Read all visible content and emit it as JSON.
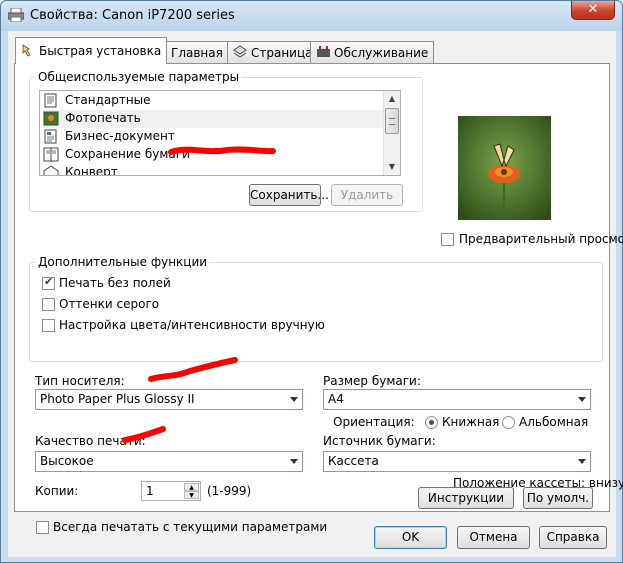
{
  "window": {
    "title": "Свойства: Canon iP7200 series",
    "close_glyph": "✕"
  },
  "tabs": [
    {
      "label": "Быстрая установка",
      "active": true,
      "icon": "quick-setup-icon"
    },
    {
      "label": "Главная",
      "active": false,
      "icon": "main-icon"
    },
    {
      "label": "Страница",
      "active": false,
      "icon": "page-setup-icon"
    },
    {
      "label": "Обслуживание",
      "active": false,
      "icon": "maintenance-icon"
    }
  ],
  "common_settings": {
    "group_label": "Общеиспользуемые параметры",
    "items": [
      {
        "label": "Стандартные",
        "icon": "standard-icon"
      },
      {
        "label": "Фотопечать",
        "icon": "photo-print-icon",
        "selected": true
      },
      {
        "label": "Бизнес-документ",
        "icon": "business-document-icon"
      },
      {
        "label": "Сохранение бумаги",
        "icon": "paper-saving-icon"
      },
      {
        "label": "Конверт",
        "icon": "envelope-icon"
      }
    ],
    "save_label": "Сохранить...",
    "delete_label": "Удалить"
  },
  "preview": {
    "checkbox_label": "Предварительный просмотр",
    "checked": false
  },
  "additional": {
    "group_label": "Дополнительные функции",
    "options": [
      {
        "label": "Печать без полей",
        "checked": true
      },
      {
        "label": "Оттенки серого",
        "checked": false
      },
      {
        "label": "Настройка цвета/интенсивности вручную",
        "checked": false
      }
    ]
  },
  "media_type": {
    "label": "Тип носителя:",
    "value": "Photo Paper Plus Glossy II"
  },
  "paper_size": {
    "label": "Размер бумаги:",
    "value": "A4"
  },
  "orientation": {
    "label": "Ориентация:",
    "portrait": "Книжная",
    "landscape": "Альбомная",
    "selected": "portrait"
  },
  "print_quality": {
    "label": "Качество печати:",
    "value": "Высокое"
  },
  "paper_source": {
    "label": "Источник бумаги:",
    "value": "Кассета"
  },
  "cassette_position": "Положение кассеты: внизу",
  "copies": {
    "label": "Копии:",
    "value": "1",
    "range": "(1-999)"
  },
  "always_print": {
    "label": "Всегда печатать с текущими параметрами",
    "checked": false
  },
  "instructions_label": "Инструкции",
  "defaults_label": "По умолч.",
  "footer": {
    "ok": "OK",
    "cancel": "Отмена",
    "help": "Справка"
  },
  "colors": {
    "annotation_red": "#ff0000",
    "window_frame": "#c9dcef",
    "close_button": "#c7432b"
  }
}
